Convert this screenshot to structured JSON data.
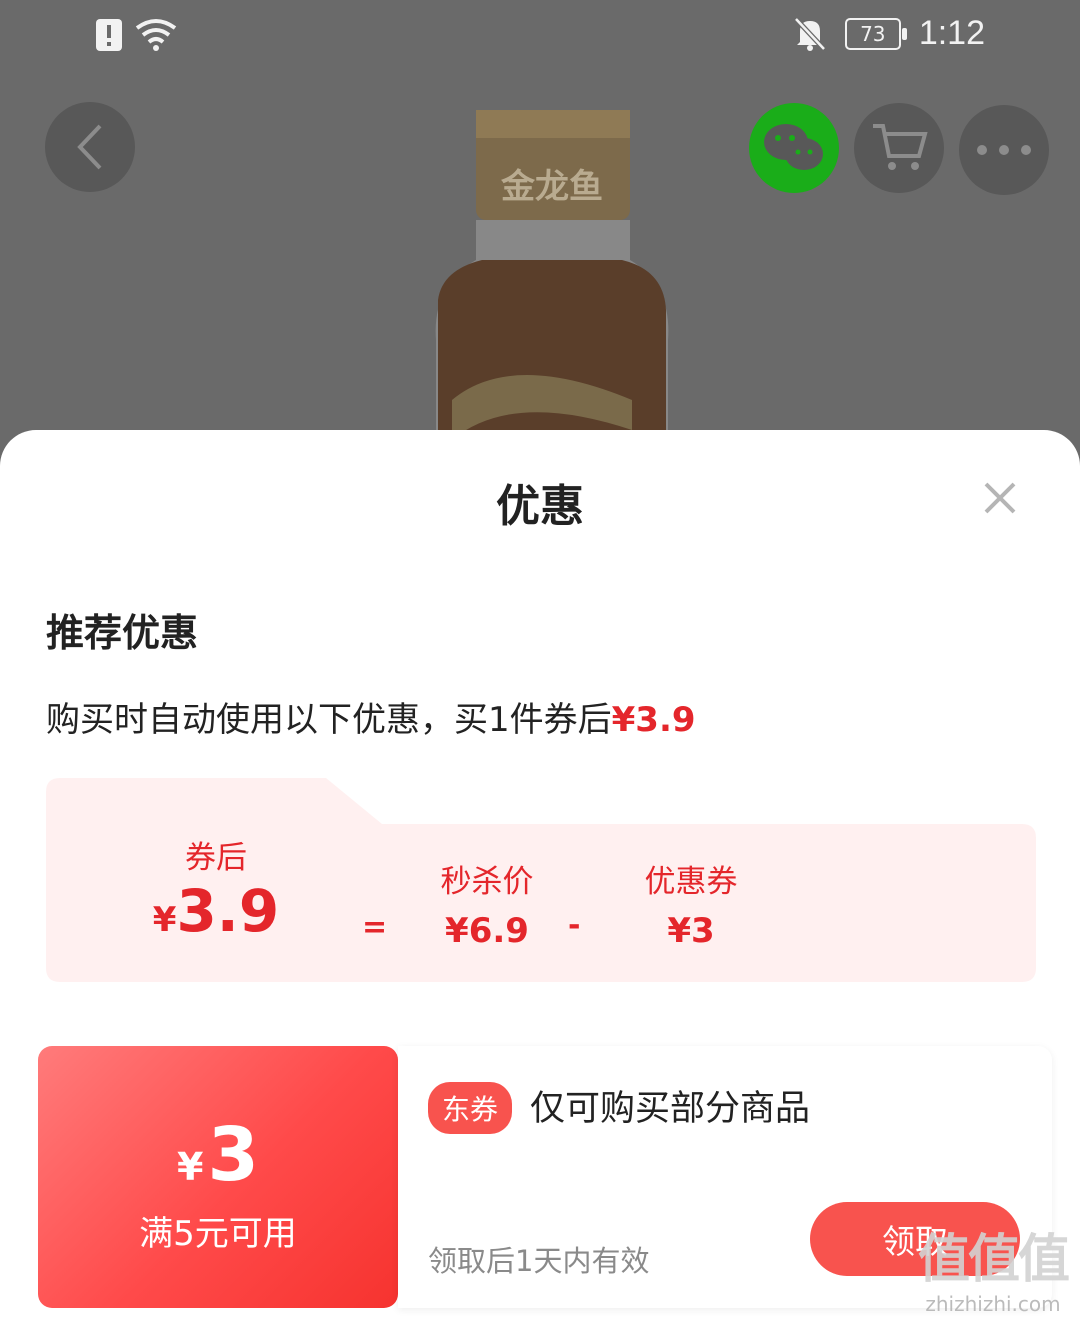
{
  "status_bar": {
    "time": "1:12",
    "battery": "73"
  },
  "product_brand_text": "金龙鱼",
  "sheet": {
    "title": "优惠",
    "section_title": "推荐优惠",
    "description_prefix": "购买时自动使用以下优惠，买1件券后",
    "description_price": "¥3.9",
    "calc": {
      "after_label": "券后",
      "after_currency": "¥",
      "after_value": "3.9",
      "equals": "=",
      "flash_label": "秒杀价",
      "flash_value": "¥6.9",
      "minus": "-",
      "coupon_label": "优惠券",
      "coupon_value": "¥3"
    },
    "coupon": {
      "currency": "¥",
      "amount": "3",
      "condition": "满5元可用",
      "tag": "东券",
      "scope": "仅可购买部分商品",
      "validity": "领取后1天内有效",
      "claim_label": "领取"
    }
  },
  "watermark": {
    "main": "值值值",
    "sub": "zhizhizhi.com"
  },
  "colors": {
    "accent": "#e4262b",
    "button": "#f8534e",
    "wechat": "#1aad19",
    "calc_bg": "#fff0f0"
  }
}
